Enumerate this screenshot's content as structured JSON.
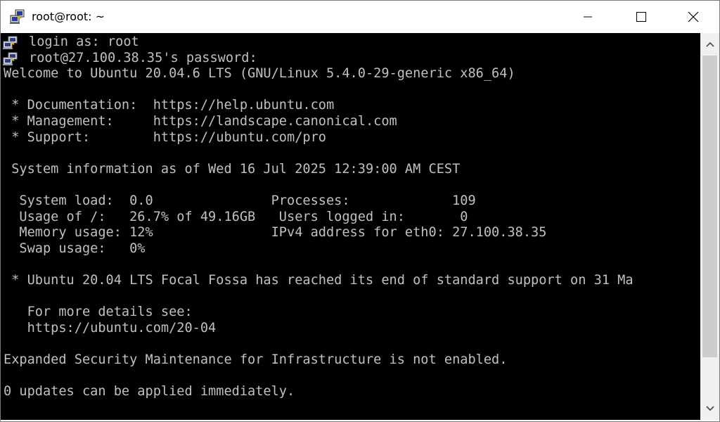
{
  "window": {
    "title": "root@root: ~",
    "icon": "putty-icon",
    "controls": {
      "minimize": "minimize-icon",
      "maximize": "maximize-icon",
      "close": "close-icon"
    }
  },
  "terminal": {
    "background": "#000000",
    "foreground": "#c0c0c0",
    "lines": [
      {
        "text": "login as: root",
        "icon": true
      },
      {
        "text": "root@27.100.38.35's password:",
        "icon": true
      },
      {
        "text": "Welcome to Ubuntu 20.04.6 LTS (GNU/Linux 5.4.0-29-generic x86_64)",
        "icon": false
      },
      {
        "text": "",
        "icon": false
      },
      {
        "text": " * Documentation:  https://help.ubuntu.com",
        "icon": false
      },
      {
        "text": " * Management:     https://landscape.canonical.com",
        "icon": false
      },
      {
        "text": " * Support:        https://ubuntu.com/pro",
        "icon": false
      },
      {
        "text": "",
        "icon": false
      },
      {
        "text": " System information as of Wed 16 Jul 2025 12:39:00 AM CEST",
        "icon": false
      },
      {
        "text": "",
        "icon": false
      },
      {
        "text": "  System load:  0.0               Processes:             109",
        "icon": false
      },
      {
        "text": "  Usage of /:   26.7% of 49.16GB   Users logged in:       0",
        "icon": false
      },
      {
        "text": "  Memory usage: 12%               IPv4 address for eth0: 27.100.38.35",
        "icon": false
      },
      {
        "text": "  Swap usage:   0%",
        "icon": false
      },
      {
        "text": "",
        "icon": false
      },
      {
        "text": " * Ubuntu 20.04 LTS Focal Fossa has reached its end of standard support on 31 Ma",
        "icon": false
      },
      {
        "text": "",
        "icon": false
      },
      {
        "text": "   For more details see:",
        "icon": false
      },
      {
        "text": "   https://ubuntu.com/20-04",
        "icon": false
      },
      {
        "text": "",
        "icon": false
      },
      {
        "text": "Expanded Security Maintenance for Infrastructure is not enabled.",
        "icon": false
      },
      {
        "text": "",
        "icon": false
      },
      {
        "text": "0 updates can be applied immediately.",
        "icon": false
      }
    ]
  },
  "scrollbar": {
    "position_fraction": 0.0,
    "visible_fraction": 0.88
  }
}
